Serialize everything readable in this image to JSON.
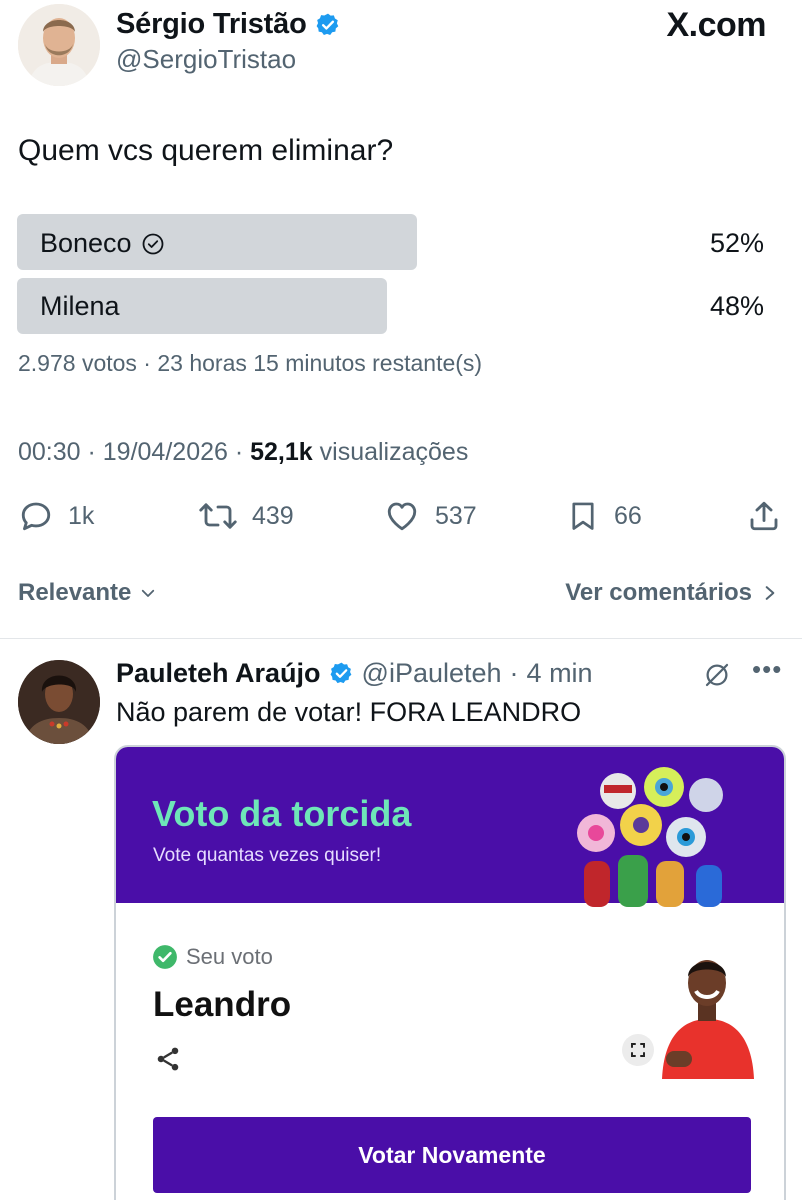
{
  "tweet": {
    "author_name": "Sérgio Tristão",
    "author_handle": "@SergioTristao",
    "site_logo": "X.com",
    "text": "Quem vcs querem eliminar?",
    "poll": {
      "options": [
        {
          "label": "Boneco",
          "percent": "52%",
          "share": 0.52,
          "winner": true
        },
        {
          "label": "Milena",
          "percent": "48%",
          "share": 0.48,
          "winner": false
        }
      ],
      "meta": "2.978 votos · 23 horas 15 minutos restante(s)"
    },
    "time": "00:30 · 19/04/2026 · ",
    "views_count": "52,1k",
    "views_label": " visualizações",
    "actions": {
      "replies": "1k",
      "retweets": "439",
      "likes": "537",
      "bookmarks": "66"
    }
  },
  "comments_bar": {
    "sort_label": "Relevante",
    "see_comments": "Ver comentários"
  },
  "reply": {
    "name": "Pauleteh Araújo",
    "handle": "@iPauleteh",
    "sep": "·",
    "time": "4 min",
    "text": "Não parem de votar! FORA LEANDRO",
    "card": {
      "title": "Voto da torcida",
      "subtitle": "Vote quantas vezes quiser!",
      "vote_label": "Seu voto",
      "vote_name": "Leandro",
      "button_label": "Votar Novamente"
    }
  },
  "colors": {
    "verified": "#1d9bf0",
    "card_purple": "#4a0ea8",
    "card_title": "#6ee6b8",
    "check_green": "#3fb86a"
  },
  "icons": [
    "verified-badge-icon",
    "check-circle-icon",
    "reply-icon",
    "retweet-icon",
    "like-icon",
    "bookmark-icon",
    "share-icon",
    "chevron-down-icon",
    "chevron-right-icon",
    "grok-icon",
    "more-icon",
    "expand-icon"
  ]
}
